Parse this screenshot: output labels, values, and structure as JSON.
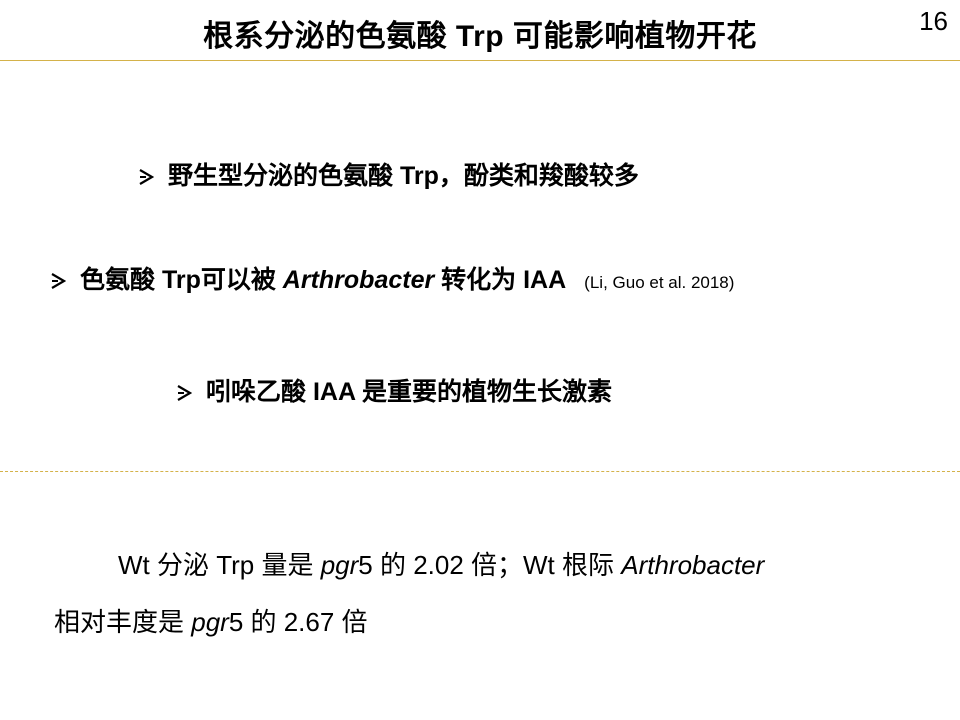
{
  "slide": {
    "title": "根系分泌的色氨酸 Trp 可能影响植物开花",
    "page_number": "16"
  },
  "bullets": [
    {
      "text": "野生型分泌的色氨酸 Trp，酚类和羧酸较多"
    },
    {
      "pre": "色氨酸 Trp可以被 ",
      "italic": "Arthrobacter",
      "post": " 转化为 IAA",
      "citation": "(Li, Guo et al. 2018)"
    },
    {
      "text": "吲哚乙酸 IAA 是重要的植物生长激素"
    }
  ],
  "paragraph": {
    "line1": {
      "a": "Wt 分泌 Trp 量是 ",
      "b_italic": "pgr",
      "c": "5 的 2.02 倍；Wt 根际 ",
      "d_italic": "Arthrobacter"
    },
    "line2": {
      "a": "相对丰度是 ",
      "b_italic": "pgr",
      "c": "5 的 2.67 倍"
    }
  },
  "colors": {
    "rule": "#d4b24a",
    "text": "#000000"
  },
  "icons": {
    "bullet": "arrow-bullet-icon"
  }
}
